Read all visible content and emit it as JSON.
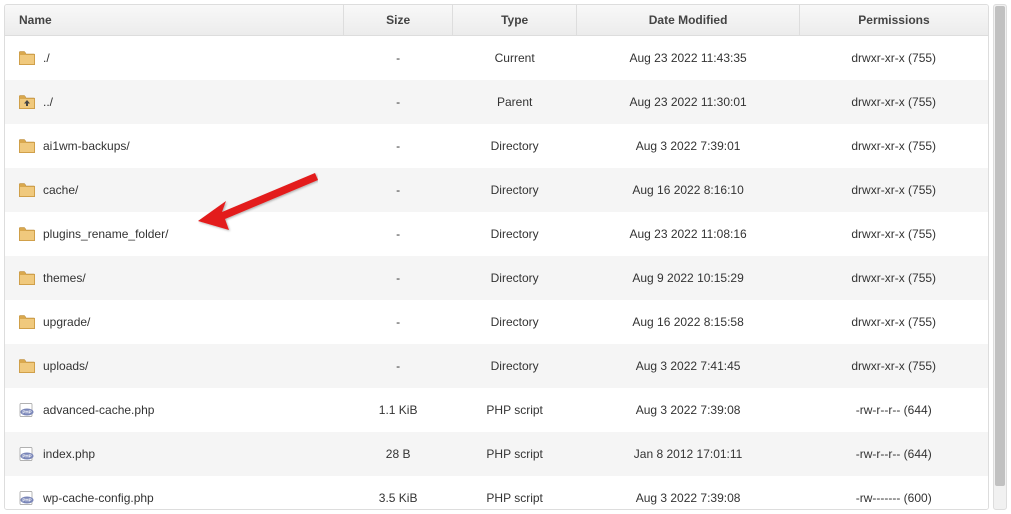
{
  "columns": {
    "name": "Name",
    "size": "Size",
    "type": "Type",
    "date": "Date Modified",
    "perm": "Permissions"
  },
  "rows": [
    {
      "icon": "folder",
      "name": "./",
      "size": "-",
      "type": "Current",
      "date": "Aug 23 2022 11:43:35",
      "perm": "drwxr-xr-x (755)"
    },
    {
      "icon": "up",
      "name": "../",
      "size": "-",
      "type": "Parent",
      "date": "Aug 23 2022 11:30:01",
      "perm": "drwxr-xr-x (755)"
    },
    {
      "icon": "folder",
      "name": "ai1wm-backups/",
      "size": "-",
      "type": "Directory",
      "date": "Aug 3 2022 7:39:01",
      "perm": "drwxr-xr-x (755)"
    },
    {
      "icon": "folder",
      "name": "cache/",
      "size": "-",
      "type": "Directory",
      "date": "Aug 16 2022 8:16:10",
      "perm": "drwxr-xr-x (755)"
    },
    {
      "icon": "folder",
      "name": "plugins_rename_folder/",
      "size": "-",
      "type": "Directory",
      "date": "Aug 23 2022 11:08:16",
      "perm": "drwxr-xr-x (755)"
    },
    {
      "icon": "folder",
      "name": "themes/",
      "size": "-",
      "type": "Directory",
      "date": "Aug 9 2022 10:15:29",
      "perm": "drwxr-xr-x (755)"
    },
    {
      "icon": "folder",
      "name": "upgrade/",
      "size": "-",
      "type": "Directory",
      "date": "Aug 16 2022 8:15:58",
      "perm": "drwxr-xr-x (755)"
    },
    {
      "icon": "folder",
      "name": "uploads/",
      "size": "-",
      "type": "Directory",
      "date": "Aug 3 2022 7:41:45",
      "perm": "drwxr-xr-x (755)"
    },
    {
      "icon": "php",
      "name": "advanced-cache.php",
      "size": "1.1 KiB",
      "type": "PHP script",
      "date": "Aug 3 2022 7:39:08",
      "perm": "-rw-r--r-- (644)"
    },
    {
      "icon": "php",
      "name": "index.php",
      "size": "28 B",
      "type": "PHP script",
      "date": "Jan 8 2012 17:01:11",
      "perm": "-rw-r--r-- (644)"
    },
    {
      "icon": "php",
      "name": "wp-cache-config.php",
      "size": "3.5 KiB",
      "type": "PHP script",
      "date": "Aug 3 2022 7:39:08",
      "perm": "-rw------- (600)"
    }
  ]
}
